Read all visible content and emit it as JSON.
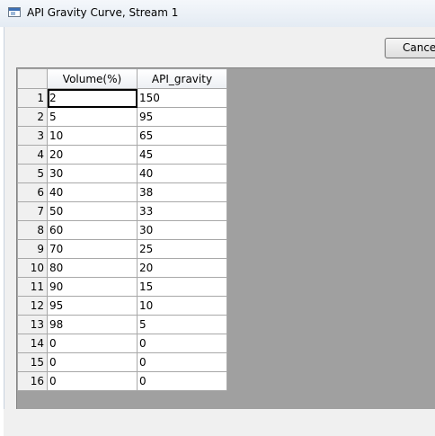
{
  "window": {
    "title": "API Gravity Curve, Stream 1"
  },
  "buttons": {
    "cancel_label": "Cancel"
  },
  "table": {
    "columns": [
      "Volume(%)",
      "API_gravity"
    ],
    "rows": [
      {
        "num": "1",
        "volume": "2",
        "api": "150"
      },
      {
        "num": "2",
        "volume": "5",
        "api": "95"
      },
      {
        "num": "3",
        "volume": "10",
        "api": "65"
      },
      {
        "num": "4",
        "volume": "20",
        "api": "45"
      },
      {
        "num": "5",
        "volume": "30",
        "api": "40"
      },
      {
        "num": "6",
        "volume": "40",
        "api": "38"
      },
      {
        "num": "7",
        "volume": "50",
        "api": "33"
      },
      {
        "num": "8",
        "volume": "60",
        "api": "30"
      },
      {
        "num": "9",
        "volume": "70",
        "api": "25"
      },
      {
        "num": "10",
        "volume": "80",
        "api": "20"
      },
      {
        "num": "11",
        "volume": "90",
        "api": "15"
      },
      {
        "num": "12",
        "volume": "95",
        "api": "10"
      },
      {
        "num": "13",
        "volume": "98",
        "api": "5"
      },
      {
        "num": "14",
        "volume": "0",
        "api": "0"
      },
      {
        "num": "15",
        "volume": "0",
        "api": "0"
      },
      {
        "num": "16",
        "volume": "0",
        "api": "0"
      }
    ]
  }
}
